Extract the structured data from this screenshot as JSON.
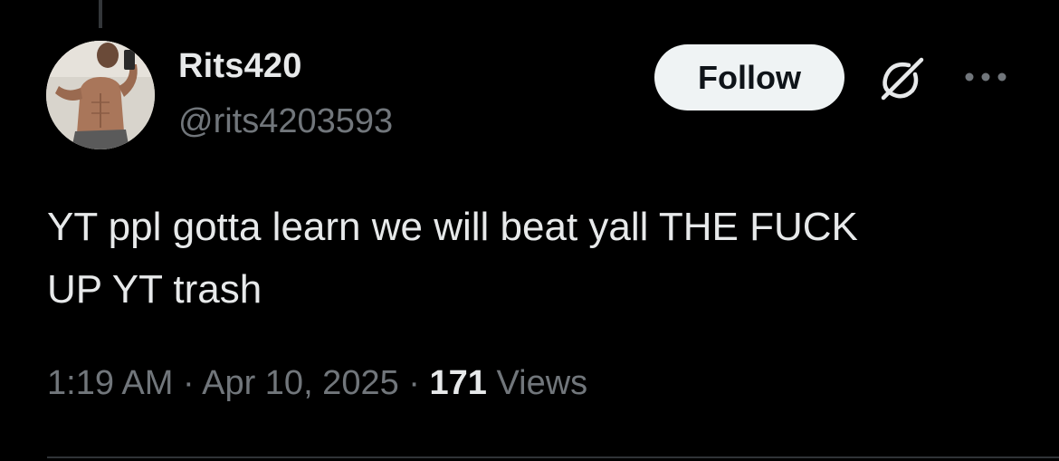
{
  "author": {
    "display_name": "Rits420",
    "handle": "@rits4203593"
  },
  "actions": {
    "follow_label": "Follow",
    "grok_icon": "grok-icon",
    "more_icon": "more-icon"
  },
  "tweet": {
    "line1": "YT ppl gotta learn we will beat yall THE FUCK",
    "line2": "UP YT trash"
  },
  "meta": {
    "time": "1:19 AM",
    "separator": " · ",
    "date": "Apr 10, 2025",
    "views_count": "171",
    "views_label": "Views"
  },
  "colors": {
    "background": "#000000",
    "primary_text": "#e7e9ea",
    "secondary_text": "#71767b",
    "follow_button_bg": "#eff3f4",
    "follow_button_text": "#0f1419"
  }
}
